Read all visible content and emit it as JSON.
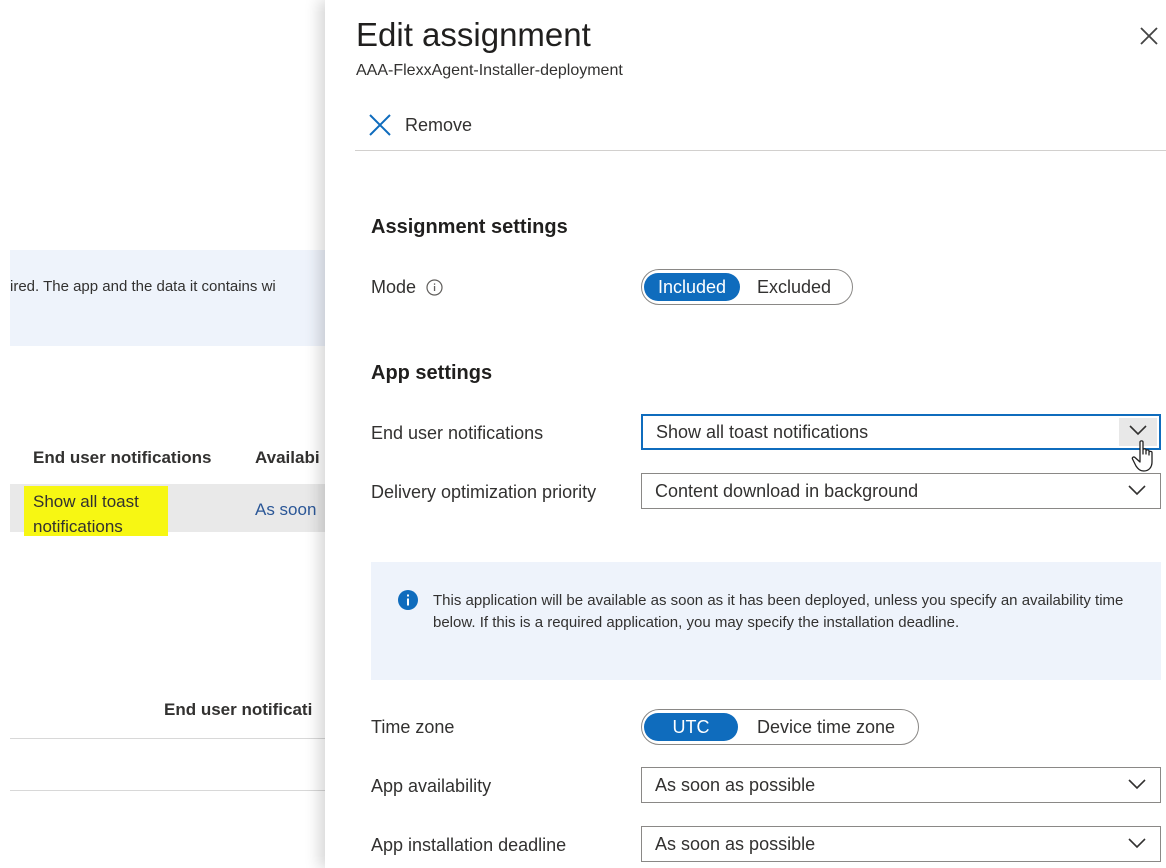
{
  "background": {
    "banner_text": "ired. The app and the data it contains wi",
    "columns": {
      "end_user_notifications": "End user notifications",
      "availability": "Availabi"
    },
    "row": {
      "notifications_value": "Show all toast notifications",
      "availability_value": "As soon"
    },
    "section_label": "End user notificati",
    "highlight_color": "#f7f713"
  },
  "panel": {
    "title": "Edit assignment",
    "subtitle": "AAA-FlexxAgent-Installer-deployment",
    "remove_label": "Remove",
    "assignment_settings": {
      "heading": "Assignment settings",
      "mode_label": "Mode",
      "mode_options": [
        "Included",
        "Excluded"
      ],
      "mode_selected": "Included"
    },
    "app_settings": {
      "heading": "App settings",
      "end_user_notifications_label": "End user notifications",
      "end_user_notifications_value": "Show all toast notifications",
      "delivery_priority_label": "Delivery optimization priority",
      "delivery_priority_value": "Content download in background",
      "info_text": "This application will be available as soon as it has been deployed, unless you specify an availability time below. If this is a required application, you may specify the installation deadline.",
      "time_zone_label": "Time zone",
      "time_zone_options": [
        "UTC",
        "Device time zone"
      ],
      "time_zone_selected": "UTC",
      "app_availability_label": "App availability",
      "app_availability_value": "As soon as possible",
      "install_deadline_label": "App installation deadline",
      "install_deadline_value": "As soon as possible"
    }
  },
  "colors": {
    "accent": "#0f6cbd",
    "info_bg": "#eef3fb"
  },
  "icons": {
    "close": "close-icon",
    "remove": "x-icon",
    "info": "info-icon",
    "chevron": "chevron-down-icon",
    "cursor": "hand-cursor-icon"
  }
}
